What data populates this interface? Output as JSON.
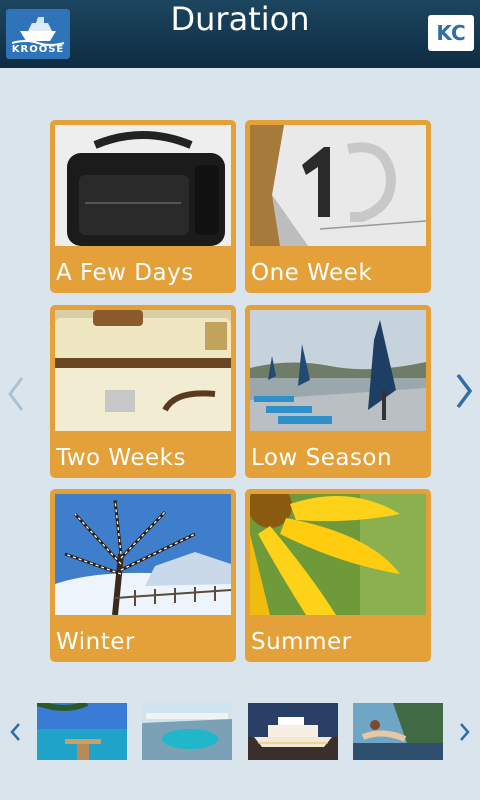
{
  "header": {
    "logo_text": "KROOSE",
    "title": "Duration",
    "user_initials": "KC"
  },
  "options": [
    {
      "label": "A Few Days"
    },
    {
      "label": "One Week"
    },
    {
      "label": "Two Weeks"
    },
    {
      "label": "Low Season"
    },
    {
      "label": "Winter"
    },
    {
      "label": "Summer"
    }
  ],
  "colors": {
    "header": "#163a53",
    "card": "#e4a13a",
    "background": "#d9e4ec",
    "accent": "#2f74b8"
  },
  "thumbnails": [
    {
      "icon": "beach-pier-image"
    },
    {
      "icon": "cruise-deck-pool-image"
    },
    {
      "icon": "cruise-ship-night-image"
    },
    {
      "icon": "woman-lounging-image"
    }
  ]
}
